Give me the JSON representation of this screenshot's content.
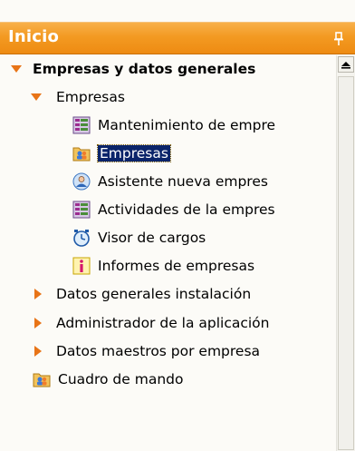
{
  "panel": {
    "title": "Inicio",
    "pin_icon": "pin-icon",
    "accent_color": "#f39a22",
    "selected_color": "#0a246a"
  },
  "tree": {
    "root": {
      "label": "Empresas y datos generales",
      "expanded": true,
      "icon": "expand-arrow-icon"
    },
    "group": {
      "label": "Empresas",
      "expanded": true
    },
    "items": [
      {
        "label": "Mantenimiento de empre",
        "icon": "grid-icon"
      },
      {
        "label": "Empresas",
        "icon": "folder-people-icon",
        "selected": true
      },
      {
        "label": "Asistente nueva empres",
        "icon": "wizard-person-icon"
      },
      {
        "label": "Actividades de la empres",
        "icon": "grid-icon"
      },
      {
        "label": "Visor de cargos",
        "icon": "clock-icon"
      },
      {
        "label": "Informes de empresas",
        "icon": "info-icon"
      }
    ],
    "collapsed_groups": [
      {
        "label": "Datos generales instalación"
      },
      {
        "label": "Administrador de la aplicación"
      },
      {
        "label": "Datos maestros por empresa"
      }
    ],
    "last_item": {
      "label": "Cuadro de mando",
      "icon": "folder-people-icon"
    }
  }
}
